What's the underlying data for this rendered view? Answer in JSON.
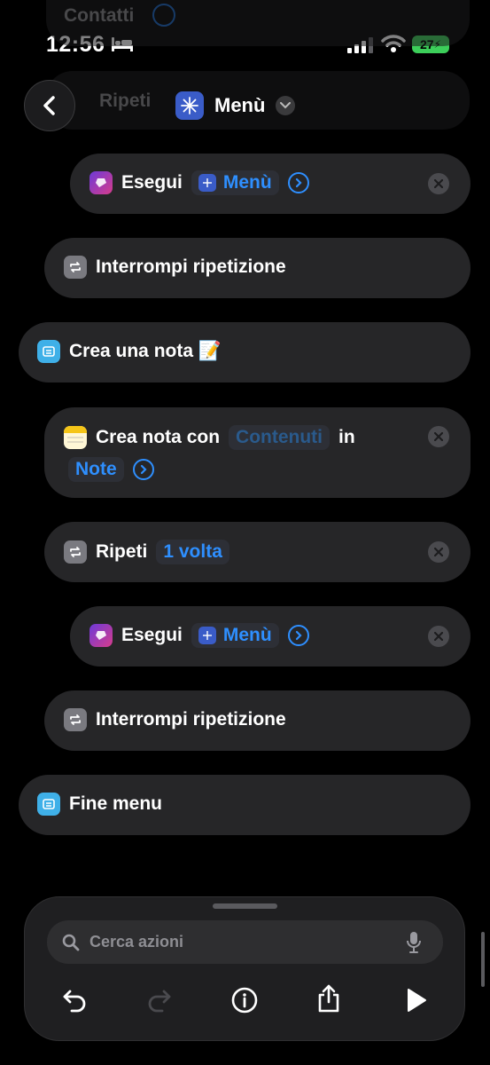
{
  "status": {
    "time": "12:56",
    "battery": "27"
  },
  "ghost_rows": {
    "top_label": "Contatti",
    "second_label": "Ripeti"
  },
  "header": {
    "title": "Menù"
  },
  "actions": [
    {
      "verb": "Esegui",
      "target": "Menù"
    },
    {
      "label": "Interrompi ripetizione"
    },
    {
      "label": "Crea una nota 📝"
    },
    {
      "verb": "Crea nota con",
      "param": "Contenuti",
      "connector": "in",
      "folder": "Note"
    },
    {
      "verb": "Ripeti",
      "count": "1 volta"
    },
    {
      "verb": "Esegui",
      "target": "Menù"
    },
    {
      "label": "Interrompi ripetizione"
    },
    {
      "label": "Fine menu"
    }
  ],
  "search": {
    "placeholder": "Cerca azioni"
  },
  "colors": {
    "accent": "#2e8fff",
    "row_bg": "#262628",
    "background": "#000000"
  }
}
